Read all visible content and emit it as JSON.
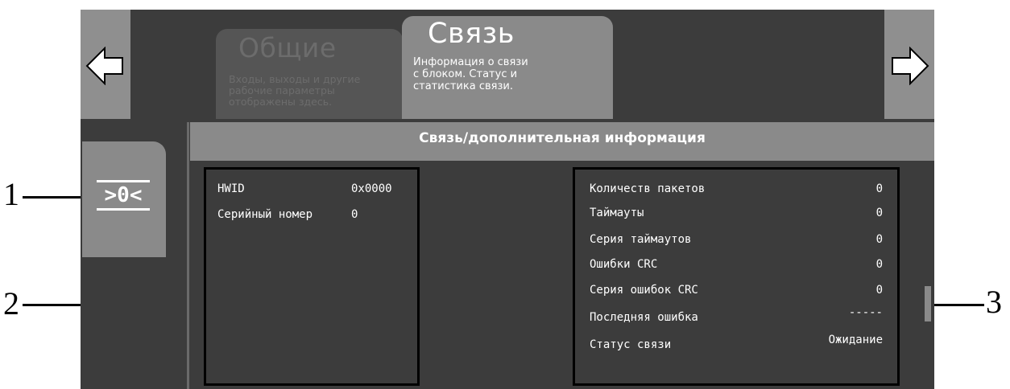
{
  "tabs": [
    {
      "title": "Общие",
      "description": "Входы, выходы и другие\nрабочие параметры\nотображены здесь."
    },
    {
      "title": "Связь",
      "description": "Информация о связи\nс блоком. Статус и\nстатистика связи."
    }
  ],
  "side": {
    "zero_label": "0"
  },
  "header": {
    "title": "Связь/дополнительная информация"
  },
  "left_panel": {
    "rows": [
      {
        "label": "HWID",
        "value": "0x0000"
      },
      {
        "label": "Серийный номер",
        "value": "0"
      }
    ]
  },
  "right_panel": {
    "rows": [
      {
        "label": "Количеств пакетов",
        "value": "0"
      },
      {
        "label": "Таймауты",
        "value": "0"
      },
      {
        "label": "Серия таймаутов",
        "value": "0"
      },
      {
        "label": "Ошибки CRC",
        "value": "0"
      },
      {
        "label": "Серия ошибок CRC",
        "value": "0"
      },
      {
        "label": "Последняя ошибка",
        "value": "-----"
      },
      {
        "label": "Статус связи",
        "value": "Ожидание"
      }
    ]
  },
  "callouts": [
    "1",
    "2",
    "3"
  ],
  "icons": {
    "nav_left": "arrow-left-icon",
    "nav_right": "arrow-right-icon",
    "zero": "zero-reset-icon"
  },
  "colors": {
    "background": "#3c3c3c",
    "panel_gray": "#8a8a8a",
    "text": "#ffffff"
  }
}
